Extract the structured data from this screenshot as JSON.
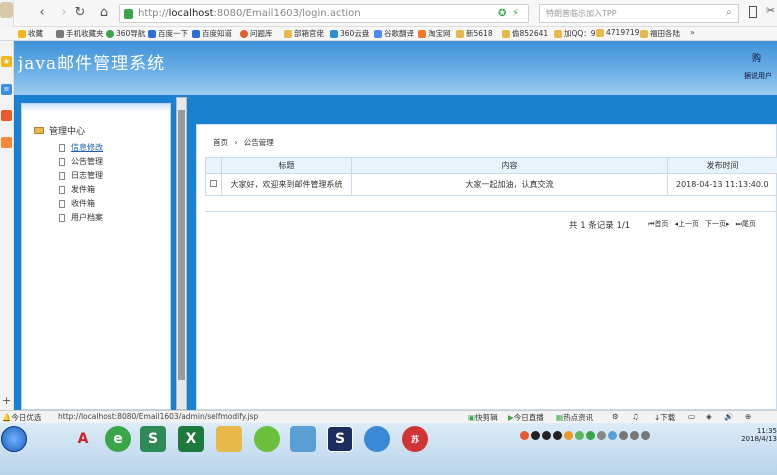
{
  "browser": {
    "url_host": "localhost",
    "url_rest": ":8080/Email1603/login.action",
    "search_placeholder": "特朗普临示加入TPP",
    "bookmarks": [
      "收藏",
      "手机收藏夹",
      "360导航",
      "百度一下",
      "百度知道",
      "问题库",
      "部箱官佬",
      "360云盘",
      "谷歌翻译",
      "淘宝网",
      "新5618",
      "偷852641",
      "加QQ：9",
      "4719719",
      "福田各陆"
    ]
  },
  "app": {
    "title": "java邮件管理系统",
    "header_right_1": "购",
    "header_right_2": "据说用户"
  },
  "sidebar": {
    "root": "管理中心",
    "items": [
      "信息修改",
      "公告管理",
      "日志管理",
      "发件箱",
      "收件箱",
      "用户档案"
    ]
  },
  "main": {
    "breadcrumb": [
      "首页",
      "公告管理"
    ],
    "columns": [
      "标题",
      "内容",
      "发布时间"
    ],
    "rows": [
      {
        "title": "大家好，欢迎来到邮件管理系统",
        "content": "大家一起加油，认真交流",
        "time": "2018-04-13 11:13:40.0"
      }
    ],
    "pager": {
      "summary": "共 1 条记录 1/1",
      "first": "首页",
      "prev": "上一页",
      "next": "下一页",
      "last": "尾页"
    }
  },
  "status": {
    "left": "今日优选",
    "url": "http://localhost:8080/Email1603/admin/selfmodify.jsp",
    "items": [
      "快剪辑",
      "今日直播",
      "热点资讯",
      "下载"
    ]
  },
  "taskbar": {
    "time": "11:35",
    "date": "2018/4/13"
  }
}
